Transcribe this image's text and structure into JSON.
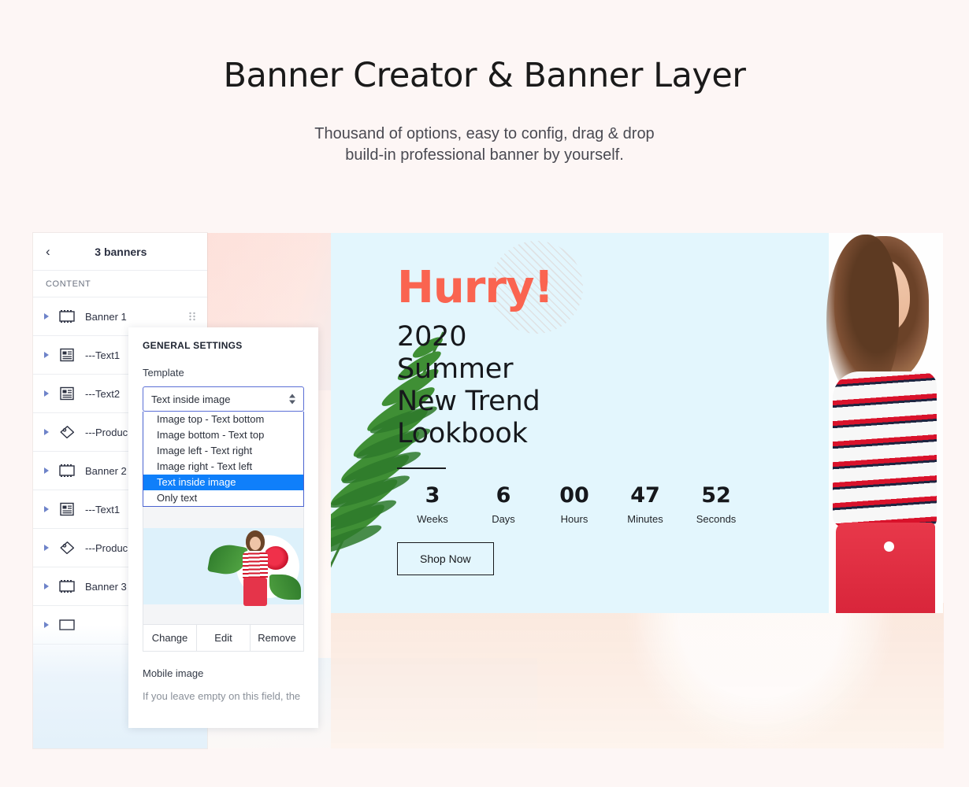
{
  "hero": {
    "title": "Banner Creator & Banner Layer",
    "subtitle_line1": "Thousand of options, easy to config, drag & drop",
    "subtitle_line2": "build-in professional banner by yourself."
  },
  "sidebar": {
    "back_icon": "chevron-left-icon",
    "title": "3 banners",
    "section_label": "CONTENT",
    "items": [
      {
        "label": "Banner 1",
        "icon": "banner-icon",
        "has_drag_handle": true
      },
      {
        "label": "---Text1",
        "icon": "text-icon",
        "has_drag_handle": false
      },
      {
        "label": "---Text2",
        "icon": "text-icon",
        "has_drag_handle": false
      },
      {
        "label": "---Produc",
        "icon": "product-tag-icon",
        "has_drag_handle": false
      },
      {
        "label": "Banner 2",
        "icon": "banner-icon",
        "has_drag_handle": false
      },
      {
        "label": "---Text1",
        "icon": "text-icon",
        "has_drag_handle": false
      },
      {
        "label": "---Produc",
        "icon": "product-tag-icon",
        "has_drag_handle": false
      },
      {
        "label": "Banner 3",
        "icon": "banner-icon",
        "has_drag_handle": false
      }
    ]
  },
  "settings": {
    "panel_title": "GENERAL SETTINGS",
    "template_label": "Template",
    "template_selected": "Text inside image",
    "template_options": [
      "Image top - Text bottom",
      "Image bottom - Text top",
      "Image left - Text right",
      "Image right - Text left",
      "Text inside image",
      "Only text"
    ],
    "template_selected_index": 4,
    "image_actions": [
      "Change",
      "Edit",
      "Remove"
    ],
    "mobile_image_label": "Mobile image",
    "mobile_image_help": "If you leave empty on this field, the",
    "highlight_color": "#0f7ffa",
    "border_color": "#5b6fd6"
  },
  "banner": {
    "eyebrow": "Hurry!",
    "headline_line1": "2020",
    "headline_line2": "Summer",
    "headline_line3": "New Trend",
    "headline_line4": "Lookbook",
    "countdown": [
      {
        "value": "3",
        "label": "Weeks"
      },
      {
        "value": "6",
        "label": "Days"
      },
      {
        "value": "00",
        "label": "Hours"
      },
      {
        "value": "47",
        "label": "Minutes"
      },
      {
        "value": "52",
        "label": "Seconds"
      }
    ],
    "cta": "Shop Now",
    "accent_color": "#fa6450",
    "background_color": "#e3f6fd"
  }
}
